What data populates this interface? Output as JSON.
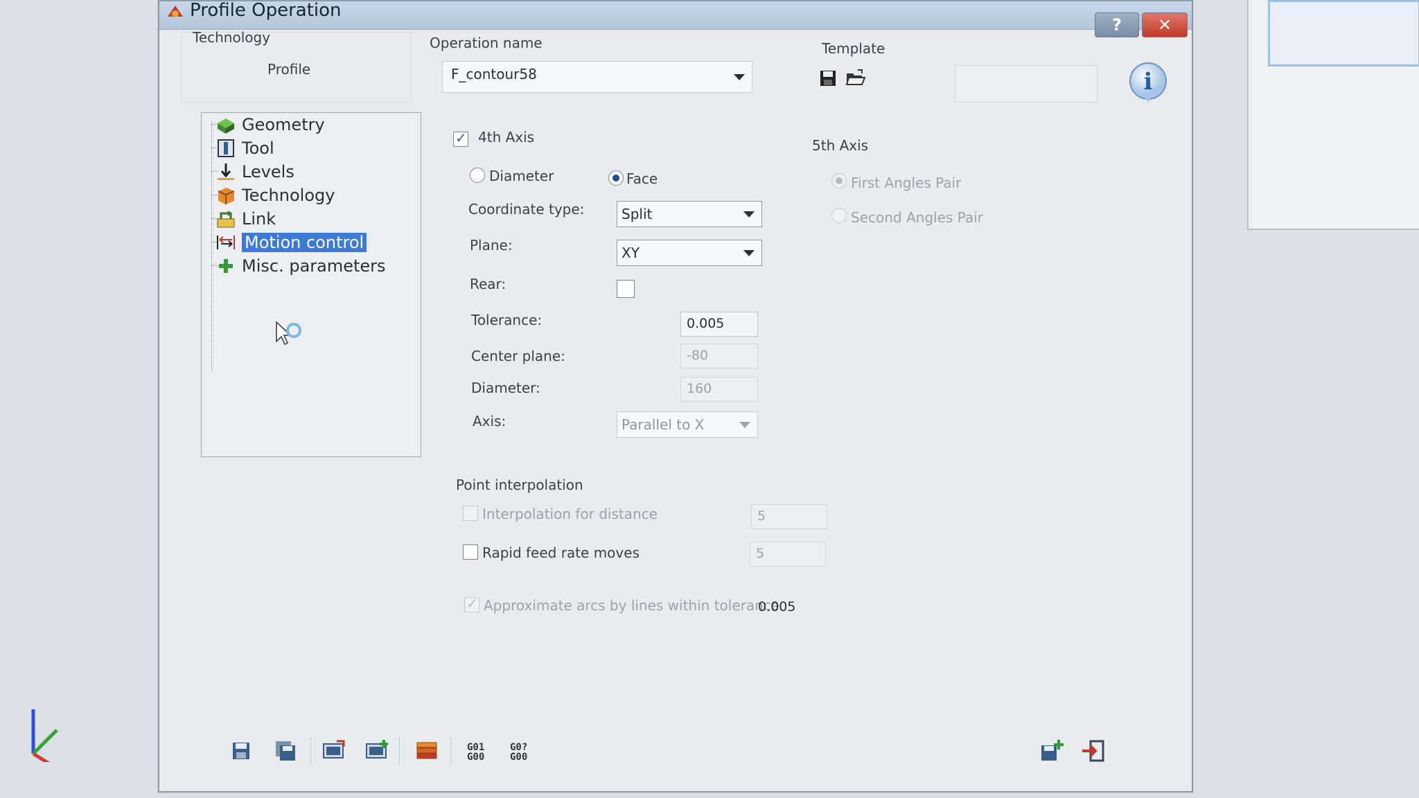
{
  "window": {
    "title": "Profile Operation",
    "help_glyph": "?",
    "close_glyph": "✕"
  },
  "header": {
    "technology_label": "Technology",
    "technology_value": "Profile",
    "operation_name_label": "Operation name",
    "operation_name_value": "F_contour58",
    "template_label": "Template",
    "template_icons": [
      "save-icon",
      "open-folder-icon"
    ],
    "info_glyph": "i"
  },
  "tree": {
    "items": [
      {
        "label": "Geometry",
        "icon": "geometry-icon"
      },
      {
        "label": "Tool",
        "icon": "tool-icon"
      },
      {
        "label": "Levels",
        "icon": "levels-icon"
      },
      {
        "label": "Technology",
        "icon": "technology-icon"
      },
      {
        "label": "Link",
        "icon": "link-icon"
      },
      {
        "label": "Motion control",
        "icon": "motion-control-icon",
        "selected": true
      },
      {
        "label": "Misc. parameters",
        "icon": "misc-parameters-icon"
      }
    ]
  },
  "fourth_axis": {
    "label": "4th Axis",
    "checked": true,
    "mode_diameter": "Diameter",
    "mode_face": "Face",
    "selected_mode": "Face",
    "coordinate_type_label": "Coordinate type:",
    "coordinate_type_value": "Split",
    "plane_label": "Plane:",
    "plane_value": "XY",
    "rear_label": "Rear:",
    "tolerance_label": "Tolerance:",
    "tolerance_value": "0.005",
    "center_plane_label": "Center plane:",
    "center_plane_value": "-80",
    "diameter_label": "Diameter:",
    "diameter_value": "160",
    "axis_label": "Axis:",
    "axis_value": "Parallel to X"
  },
  "fifth_axis": {
    "label": "5th Axis",
    "first_pair": "First Angles Pair",
    "second_pair": "Second Angles Pair"
  },
  "point_interpolation": {
    "label": "Point interpolation",
    "interp_distance_label": "Interpolation for distance",
    "interp_distance_value": "5",
    "rapid_feed_label": "Rapid feed rate moves",
    "rapid_feed_value": "5",
    "approx_arcs_label": "Approximate arcs by lines within tolerance",
    "approx_arcs_value": "0.005"
  },
  "toolbar": {
    "gcode1": [
      "G01",
      "G00"
    ],
    "gcode2": [
      "G0?",
      "G00"
    ]
  },
  "colors": {
    "selection": "#3d7ad6",
    "close": "#c0392b",
    "titlebar": "#b4c6da"
  }
}
